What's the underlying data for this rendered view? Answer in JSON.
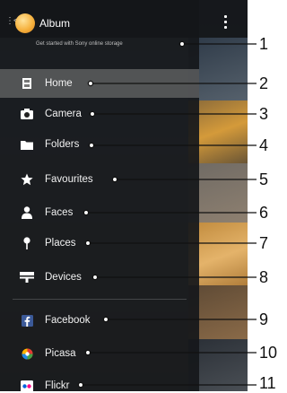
{
  "header": {
    "title": "Album"
  },
  "account": {
    "text": "Get started with Sony online storage"
  },
  "menu": {
    "items": [
      {
        "label": "Home",
        "icon": "home-icon"
      },
      {
        "label": "Camera",
        "icon": "camera-icon"
      },
      {
        "label": "Folders",
        "icon": "folder-icon"
      },
      {
        "label": "Favourites",
        "icon": "star-icon"
      },
      {
        "label": "Faces",
        "icon": "person-icon"
      },
      {
        "label": "Places",
        "icon": "place-pin-icon"
      },
      {
        "label": "Devices",
        "icon": "devices-icon"
      },
      {
        "label": "Facebook",
        "icon": "facebook-icon"
      },
      {
        "label": "Picasa",
        "icon": "picasa-icon"
      },
      {
        "label": "Flickr",
        "icon": "flickr-icon"
      }
    ]
  },
  "callouts": [
    "1",
    "2",
    "3",
    "4",
    "5",
    "6",
    "7",
    "8",
    "9",
    "10",
    "11"
  ],
  "colors": {
    "drawer_bg": "#16181b",
    "active_item_bg": "#828282",
    "app_icon": "#f6b23f",
    "facebook": "#3b5998"
  }
}
